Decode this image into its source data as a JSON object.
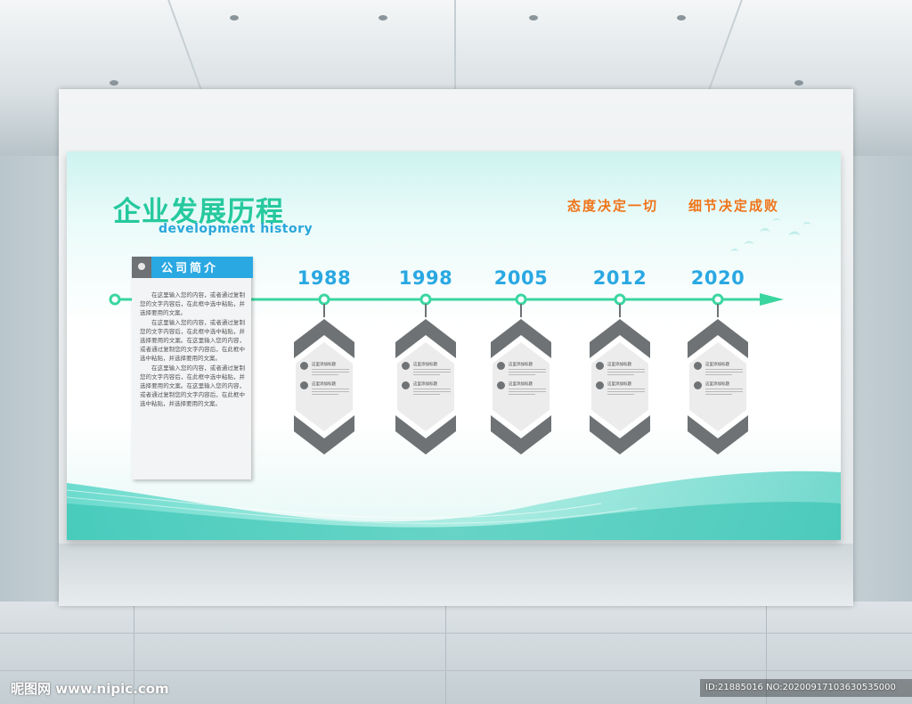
{
  "poster": {
    "title_cn": "企业发展历程",
    "title_en": "development history",
    "slogans": [
      "态度决定一切",
      "细节决定成败"
    ],
    "colors": {
      "title": "#26c99e",
      "accent": "#2aa8e2",
      "slogan": "#f07318",
      "timeline": "#3ad6a0",
      "card": "#6e7274"
    }
  },
  "intro": {
    "title": "公司简介",
    "paragraphs": [
      "在这里输入您的内容，或者通过复制您的文字内容后，在此框中选中粘贴，并选择要用的文案。",
      "在这里输入您的内容，或者通过复制您的文字内容后，在此框中选中粘贴，并选择要用的文案。在这里输入您的内容，或者通过复制您的文字内容后，在此框中选中粘贴，并选择要用的文案。",
      "在这里输入您的内容，或者通过复制您的文字内容后，在此框中选中粘贴，并选择要用的文案。在这里输入您的内容，或者通过复制您的文字内容后，在此框中选中粘贴，并选择要用的文案。"
    ]
  },
  "timeline": {
    "years": [
      "1988",
      "1998",
      "2005",
      "2012",
      "2020"
    ],
    "item_title": "这里添加标题"
  },
  "watermark": {
    "left": "昵图网 www.nipic.com",
    "right": "ID:21885016 NO:20200917103630535000"
  }
}
